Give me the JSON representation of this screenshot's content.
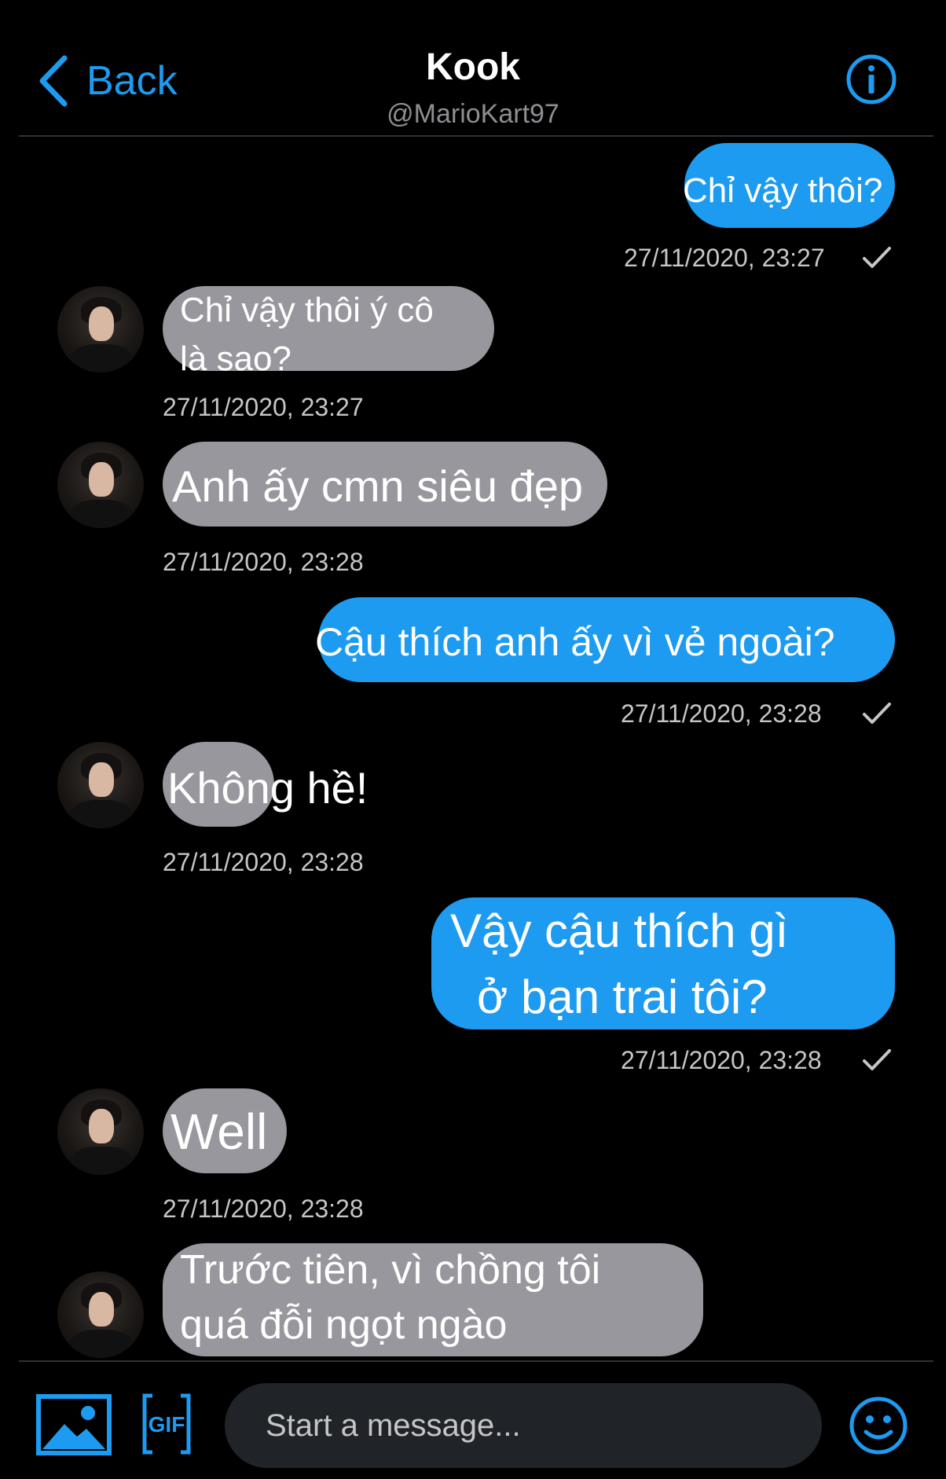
{
  "header": {
    "back_label": "Back",
    "contact_name": "Kook",
    "contact_handle": "@MarioKart97"
  },
  "messages": [
    {
      "side": "sent",
      "text_lines": [
        "Chỉ vậy thôi?"
      ],
      "time": "27/11/2020, 23:27",
      "read": true
    },
    {
      "side": "received",
      "text_lines": [
        "Chỉ vậy thôi ý cô",
        "là sao?"
      ],
      "time": "27/11/2020, 23:27"
    },
    {
      "side": "received",
      "text_lines": [
        "Anh ấy cmn siêu đẹp"
      ],
      "time": "27/11/2020, 23:28"
    },
    {
      "side": "sent",
      "text_lines": [
        "Cậu thích anh ấy vì vẻ ngoài?"
      ],
      "time": "27/11/2020, 23:28",
      "read": true
    },
    {
      "side": "received",
      "text_lines": [
        "Không hề!"
      ],
      "time": "27/11/2020, 23:28"
    },
    {
      "side": "sent",
      "text_lines": [
        "Vậy cậu thích gì",
        "ở bạn trai tôi?"
      ],
      "time": "27/11/2020, 23:28",
      "read": true
    },
    {
      "side": "received",
      "text_lines": [
        "Well"
      ],
      "time": "27/11/2020, 23:28"
    },
    {
      "side": "received",
      "text_lines": [
        "Trước tiên, vì chồng tôi",
        "quá đỗi ngọt ngào"
      ],
      "time": ""
    }
  ],
  "composer": {
    "placeholder": "Start a message...",
    "media_icon": "image-icon",
    "gif_icon": "gif-icon",
    "emoji_icon": "emoji-icon"
  },
  "colors": {
    "accent": "#1d9bf0",
    "sent_bubble": "#1d9bf0",
    "received_bubble": "#97979d",
    "background": "#000000"
  }
}
